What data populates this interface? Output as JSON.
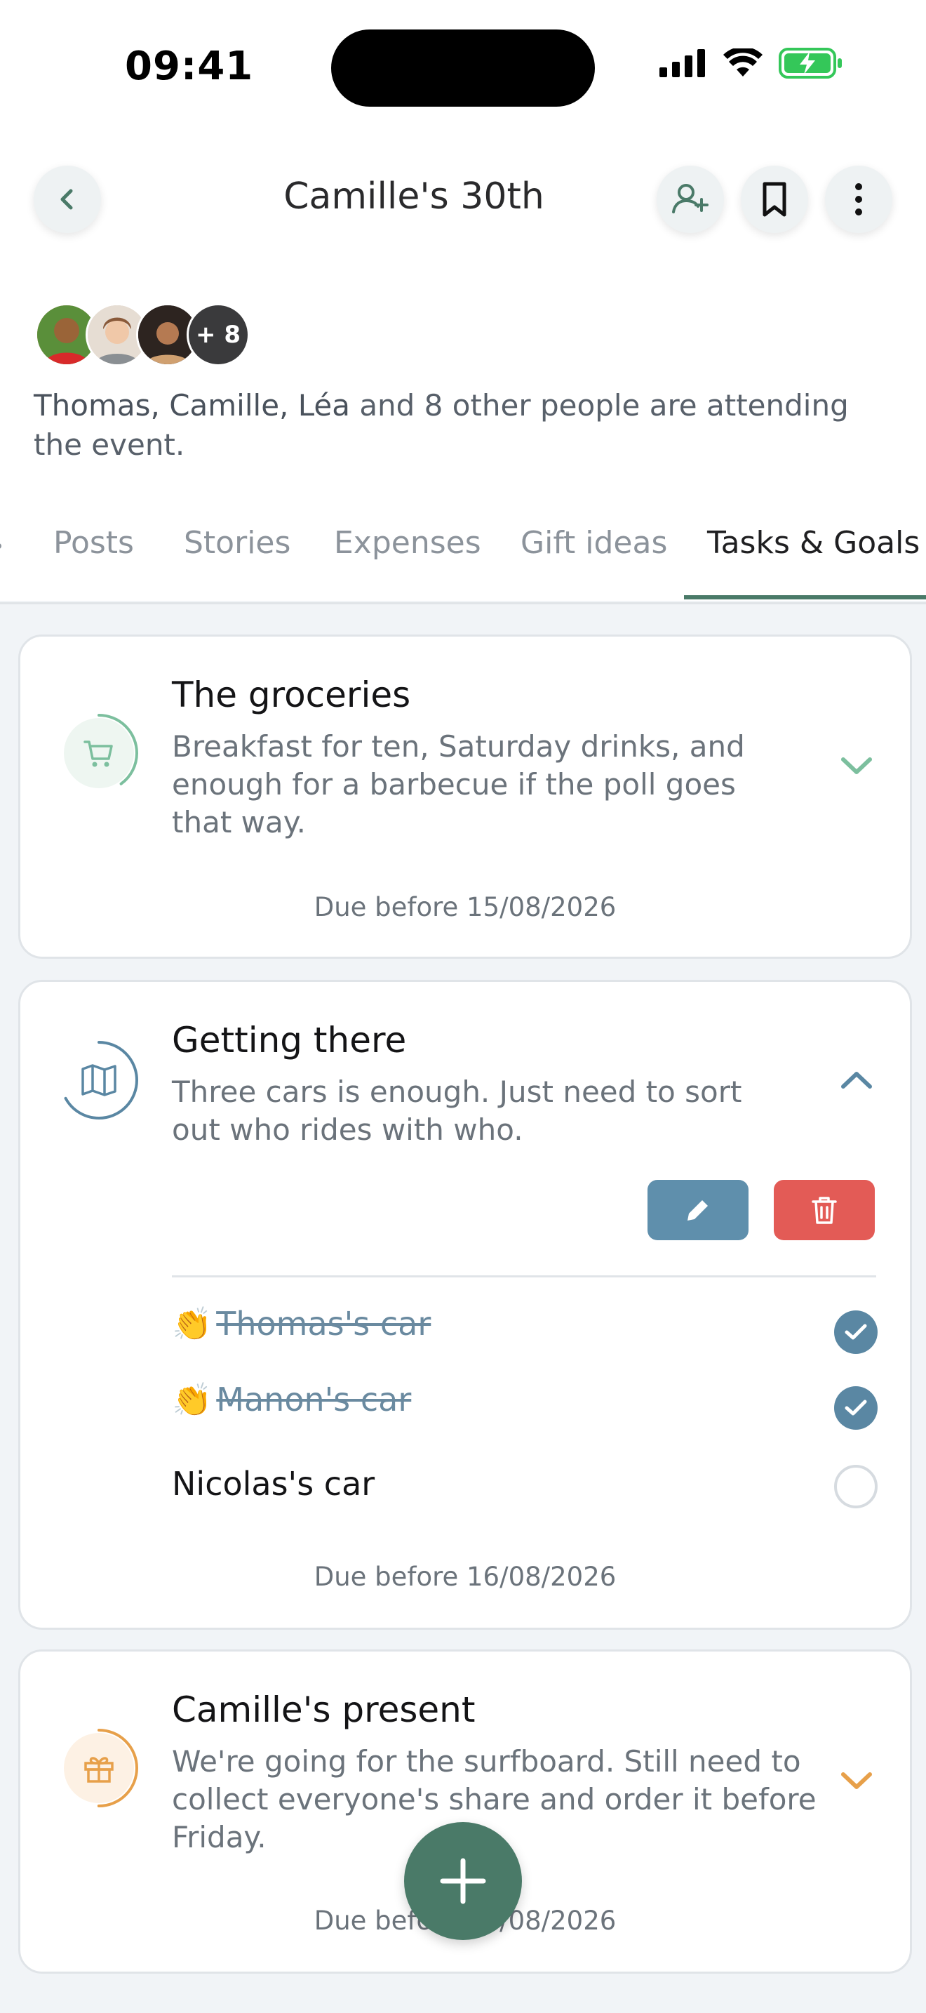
{
  "status_bar": {
    "time": "09:41"
  },
  "header": {
    "title": "Camille's 30th"
  },
  "attendees": {
    "more_count": "+ 8",
    "names": "Thomas, Camille, Léa",
    "suffix": " and 8 other people are attending the event."
  },
  "tabs": [
    {
      "label": "Posts"
    },
    {
      "label": "Stories"
    },
    {
      "label": "Expenses"
    },
    {
      "label": "Gift ideas"
    },
    {
      "label": "Tasks & Goals",
      "active": true
    }
  ],
  "tasks": [
    {
      "title": "The groceries",
      "description": "Breakfast for ten, Saturday drinks, and enough for a barbecue if the poll goes that way.",
      "due": "Due before 15/08/2026",
      "icon": "cart-icon",
      "color": "#7cbf9e",
      "progress": 0.4,
      "expanded": false
    },
    {
      "title": "Getting there",
      "description": "Three cars is enough. Just need to sort out who rides with who.",
      "due": "Due before 16/08/2026",
      "icon": "map-icon",
      "color": "#5a87a3",
      "progress": 0.67,
      "expanded": true,
      "items": [
        {
          "emoji": "👏",
          "label": "Thomas's car",
          "done": true
        },
        {
          "emoji": "👏",
          "label": "Manon's car",
          "done": true
        },
        {
          "label": "Nicolas's car",
          "done": false
        }
      ]
    },
    {
      "title": "Camille's present",
      "description": "We're going for the surfboard. Still need to collect everyone's share and order it before Friday.",
      "due": "Due before 19/08/2026",
      "icon": "gift-icon",
      "color": "#e7a04a",
      "progress": 0.5,
      "expanded": false
    }
  ]
}
